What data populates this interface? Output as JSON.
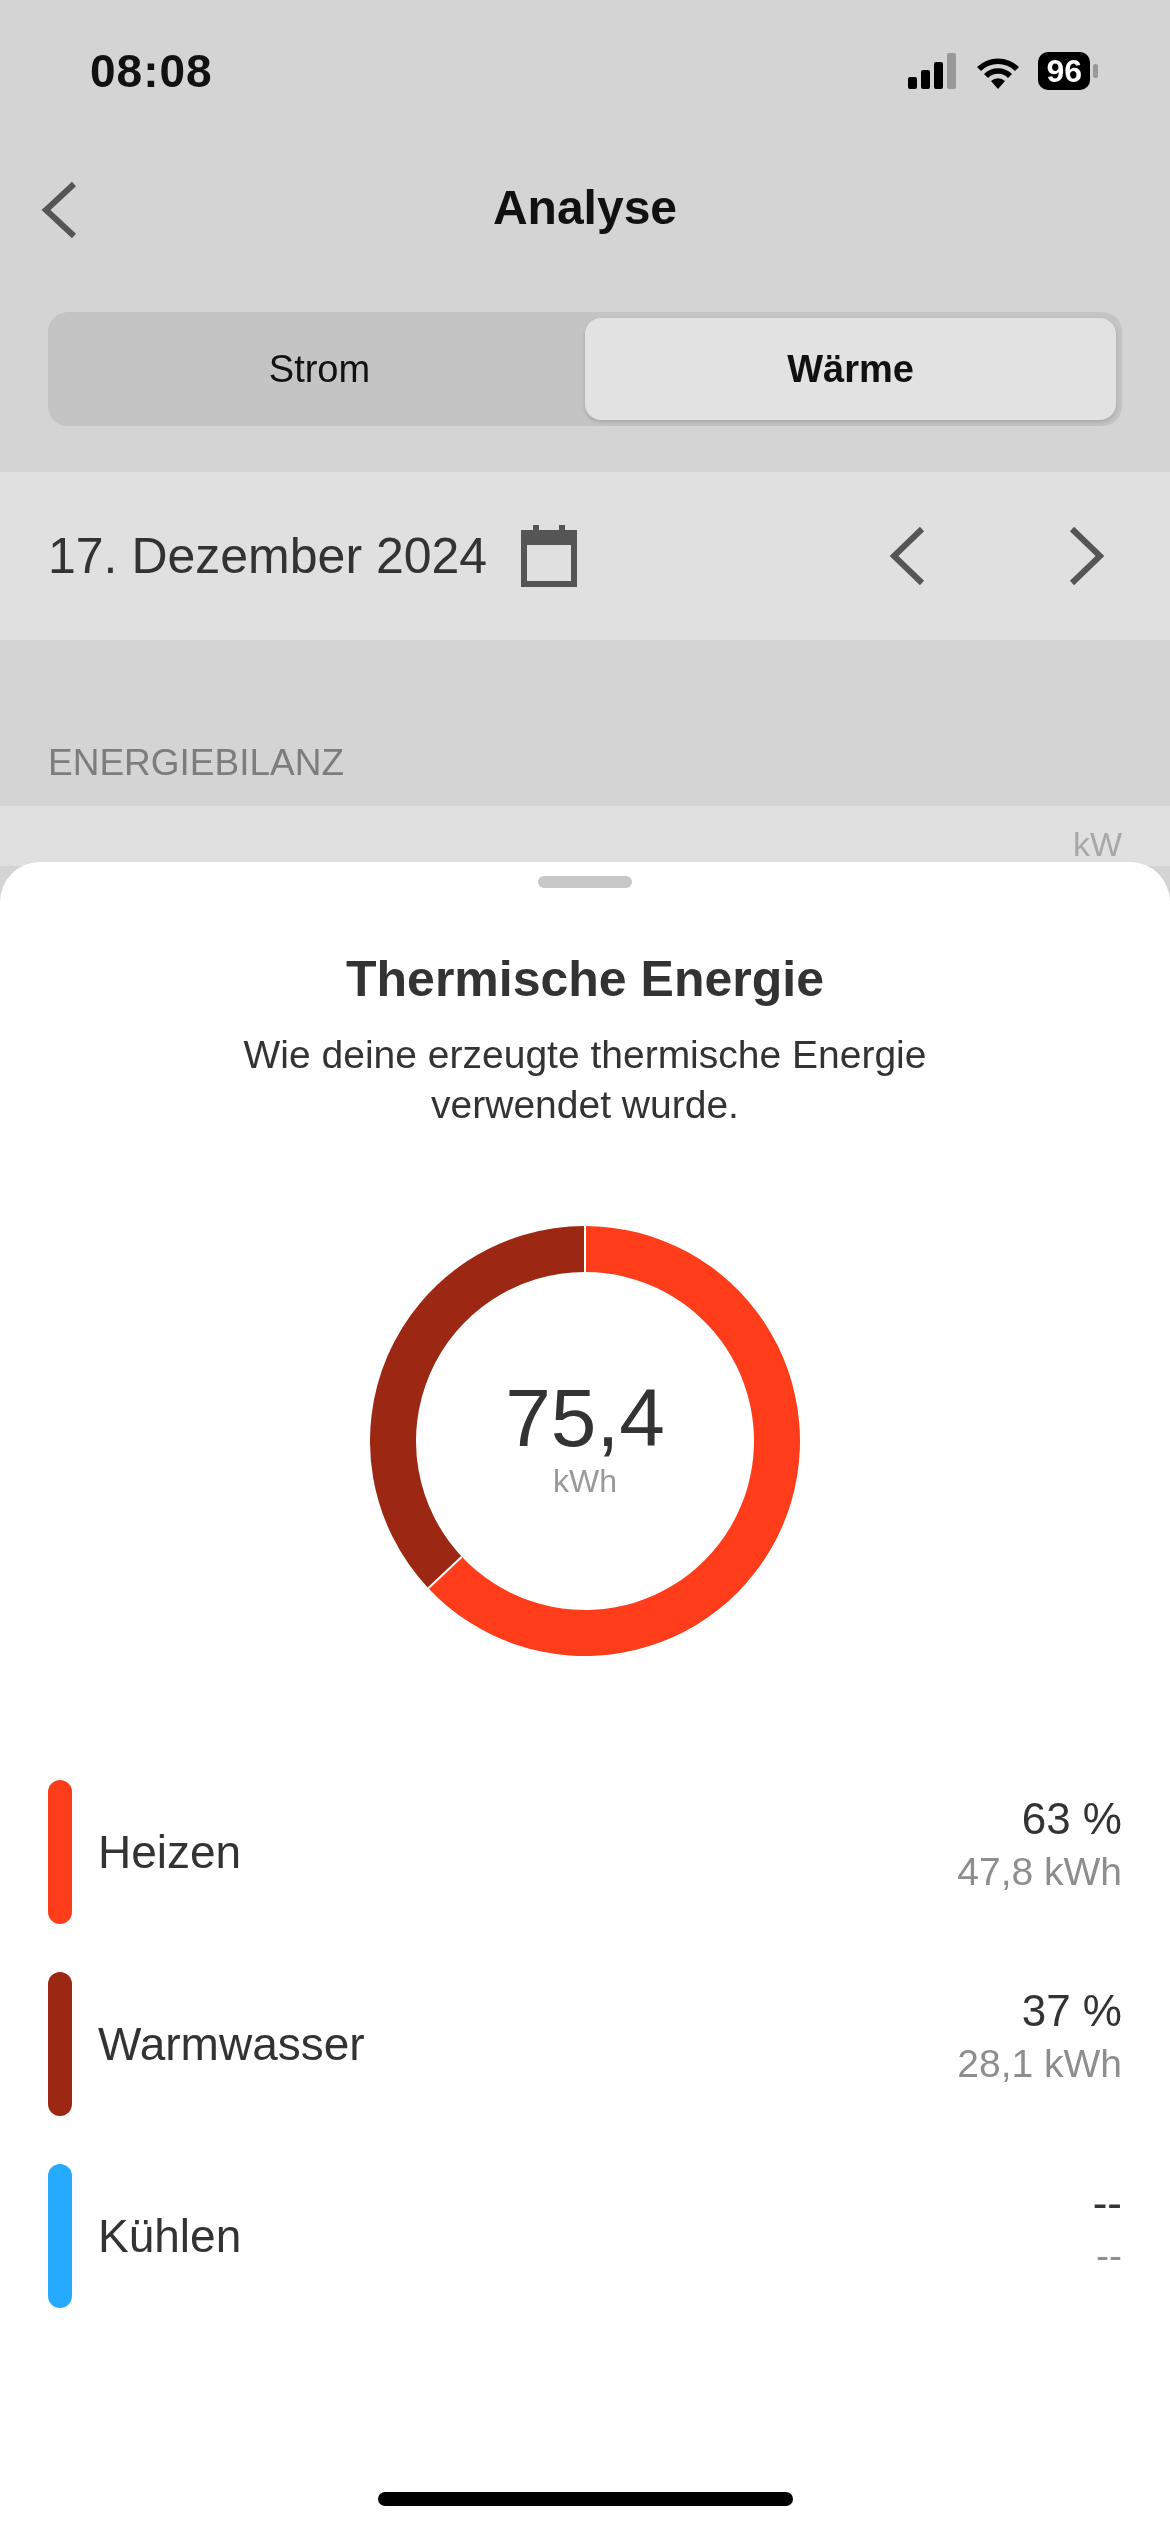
{
  "status_bar": {
    "time": "08:08",
    "battery": "96"
  },
  "nav": {
    "title": "Analyse"
  },
  "tabs": [
    {
      "label": "Strom",
      "selected": false
    },
    {
      "label": "Wärme",
      "selected": true
    }
  ],
  "date_bar": {
    "date": "17. Dezember 2024"
  },
  "section": {
    "title": "ENERGIEBILANZ",
    "unit": "kW"
  },
  "sheet": {
    "title": "Thermische Energie",
    "subtitle": "Wie deine erzeugte thermische Energie verwendet wurde.",
    "total": "75,4",
    "total_unit": "kWh",
    "chart_data": {
      "type": "donut",
      "categories": [
        "Heizen",
        "Warmwasser",
        "Kühlen"
      ],
      "values": [
        63,
        37,
        null
      ]
    },
    "legend": [
      {
        "color": "#ff3d1a",
        "percent": "63 %",
        "amount": "47,8 kWh"
      },
      {
        "color": "#9c2814",
        "percent": "37 %",
        "amount": "28,1 kWh"
      },
      {
        "color": "#26aaff",
        "percent": "--",
        "amount": "--"
      }
    ]
  }
}
